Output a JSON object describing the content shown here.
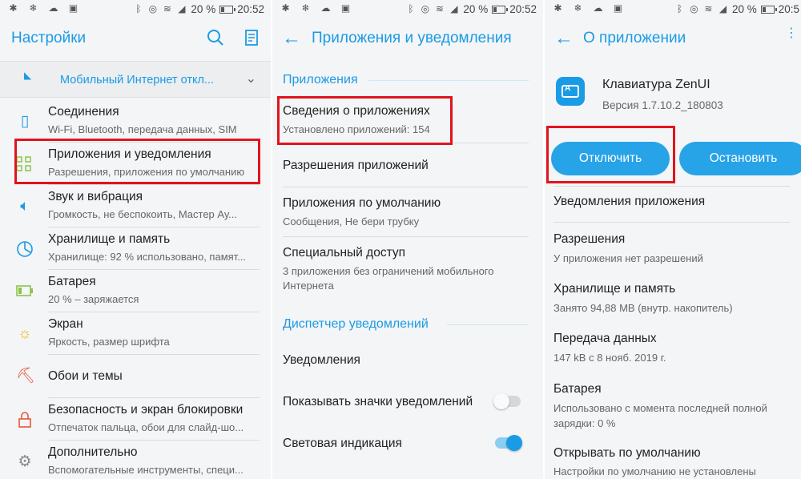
{
  "status": {
    "battery_percent": "20 %",
    "time_1": "20:52",
    "time_2": "20:52",
    "time_3": "20:5"
  },
  "panel1": {
    "title": "Настройки",
    "mobile_data_label": "Мобильный Интернет откл...",
    "items": [
      {
        "title": "Соединения",
        "subtitle": "Wi-Fi, Bluetooth, передача данных, SIM"
      },
      {
        "title": "Приложения и уведомления",
        "subtitle": "Разрешения, приложения по умолчанию"
      },
      {
        "title": "Звук и вибрация",
        "subtitle": "Громкость, не беспокоить, Мастер Ау..."
      },
      {
        "title": "Хранилище и память",
        "subtitle": "Хранилище: 92 % использовано, памят..."
      },
      {
        "title": "Батарея",
        "subtitle": "20 % – заряжается"
      },
      {
        "title": "Экран",
        "subtitle": "Яркость, размер шрифта"
      },
      {
        "title": "Обои и темы",
        "subtitle": ""
      },
      {
        "title": "Безопасность и экран блокировки",
        "subtitle": "Отпечаток пальца, обои для слайд-шо..."
      },
      {
        "title": "Дополнительно",
        "subtitle": "Вспомогательные инструменты, специ..."
      }
    ]
  },
  "panel2": {
    "title": "Приложения и уведомления",
    "section_apps": "Приложения",
    "app_info_title": "Сведения о приложениях",
    "app_info_subtitle": "Установлено приложений: 154",
    "app_permissions": "Разрешения приложений",
    "default_apps_title": "Приложения по умолчанию",
    "default_apps_subtitle": "Сообщения, Не бери трубку",
    "special_access_title": "Специальный доступ",
    "special_access_subtitle": "3 приложения без ограничений мобильного Интернета",
    "section_notifications": "Диспетчер уведомлений",
    "notifications": "Уведомления",
    "badges_label": "Показывать значки уведомлений",
    "badges_on": false,
    "led_label": "Световая индикация",
    "led_on": true
  },
  "panel3": {
    "title": "О приложении",
    "app_name": "Клавиатура ZenUI",
    "app_version": "Версия 1.7.10.2_180803",
    "disable_button": "Отключить",
    "stop_button": "Остановить",
    "notif_title": "Уведомления приложения",
    "perm_title": "Разрешения",
    "perm_subtitle": "У приложения нет разрешений",
    "storage_title": "Хранилище и память",
    "storage_subtitle": "Занято 94,88 MB (внутр. накопитель)",
    "data_title": "Передача данных",
    "data_subtitle": "147 kB с 8 нояб. 2019 г.",
    "battery_title": "Батарея",
    "battery_subtitle": "Использовано с момента последней полной зарядки: 0 %",
    "open_title": "Открывать по умолчанию",
    "open_subtitle": "Настройки по умолчанию не установлены"
  },
  "colors": {
    "accent": "#1a9be6",
    "highlight": "#e0141e"
  }
}
